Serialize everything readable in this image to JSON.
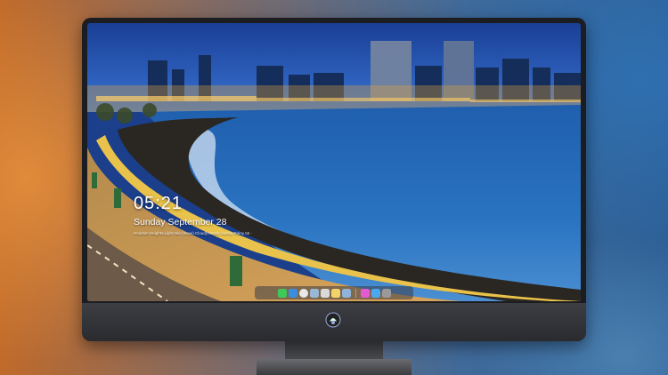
{
  "desktop": {
    "clock": {
      "time": "05:21",
      "date": "Sunday September  28",
      "weather_line": "Houston Heights   Light rain (snow)  Cloudy   Mostly Sunny   Rainy 55 ·"
    }
  },
  "dock": {
    "apps": [
      {
        "name": "messages-icon",
        "color": "#3fc95a"
      },
      {
        "name": "finder-icon",
        "color": "#3b8de0"
      },
      {
        "name": "clock-icon",
        "color": "#e8e8e8"
      },
      {
        "name": "preview-icon",
        "color": "#9bb7d6"
      },
      {
        "name": "video-editor-icon",
        "color": "#d9d9d9"
      },
      {
        "name": "notes-icon",
        "color": "#f3d26b"
      },
      {
        "name": "photos-icon",
        "color": "#8fb3d9"
      },
      {
        "name": "itunes-icon",
        "color": "#e35bd0"
      },
      {
        "name": "app-store-icon",
        "color": "#4aa7f0"
      },
      {
        "name": "camera-icon",
        "color": "#9a9a9a"
      }
    ]
  }
}
